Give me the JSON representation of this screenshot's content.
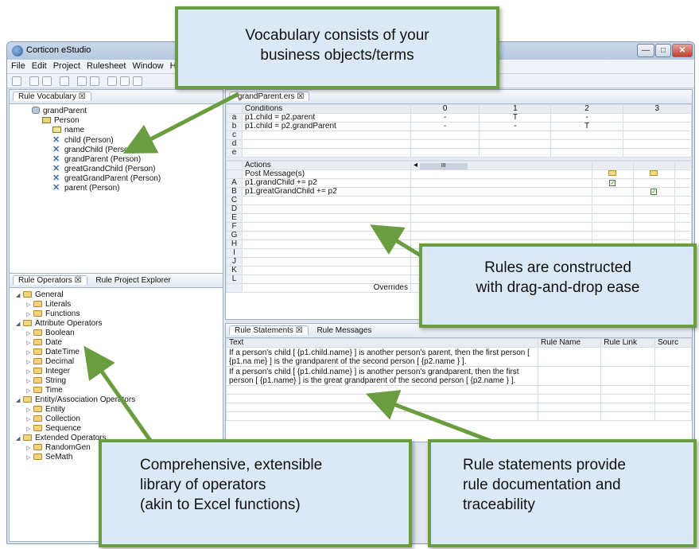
{
  "window": {
    "title": "Corticon eStudio",
    "minimize": "—",
    "maximize": "□",
    "close": "✕"
  },
  "menu": [
    "File",
    "Edit",
    "Project",
    "Rulesheet",
    "Window",
    "H"
  ],
  "vocabulary": {
    "tab": "Rule Vocabulary ☒",
    "root": "grandParent",
    "entity": "Person",
    "attribute": "name",
    "associations": [
      "child (Person)",
      "grandChild (Person)",
      "grandParent (Person)",
      "greatGrandChild (Person)",
      "greatGrandParent (Person)",
      "parent (Person)"
    ]
  },
  "operators": {
    "tab": "Rule Operators ☒",
    "tab2": "Rule Project Explorer",
    "items": [
      {
        "level": 0,
        "open": true,
        "label": "General"
      },
      {
        "level": 1,
        "open": false,
        "label": "Literals"
      },
      {
        "level": 1,
        "open": false,
        "label": "Functions"
      },
      {
        "level": 0,
        "open": true,
        "label": "Attribute Operators"
      },
      {
        "level": 1,
        "open": false,
        "label": "Boolean"
      },
      {
        "level": 1,
        "open": false,
        "label": "Date"
      },
      {
        "level": 1,
        "open": false,
        "label": "DateTime"
      },
      {
        "level": 1,
        "open": false,
        "label": "Decimal"
      },
      {
        "level": 1,
        "open": false,
        "label": "Integer"
      },
      {
        "level": 1,
        "open": false,
        "label": "String"
      },
      {
        "level": 1,
        "open": false,
        "label": "Time"
      },
      {
        "level": 0,
        "open": true,
        "label": "Entity/Association Operators"
      },
      {
        "level": 1,
        "open": false,
        "label": "Entity"
      },
      {
        "level": 1,
        "open": false,
        "label": "Collection"
      },
      {
        "level": 1,
        "open": false,
        "label": "Sequence"
      },
      {
        "level": 0,
        "open": true,
        "label": "Extended Operators"
      },
      {
        "level": 1,
        "open": false,
        "label": "RandomGen"
      },
      {
        "level": 1,
        "open": false,
        "label": "SeMath"
      }
    ]
  },
  "rulesheet": {
    "tab": "*grandParent.ers ☒",
    "conditions_header": "Conditions",
    "columns": [
      "0",
      "1",
      "2",
      "3"
    ],
    "conditions": [
      {
        "id": "a",
        "text": "p1.child = p2.parent",
        "vals": [
          "-",
          "T",
          "-",
          ""
        ]
      },
      {
        "id": "b",
        "text": "p1.child = p2.grandParent",
        "vals": [
          "-",
          "-",
          "T",
          ""
        ]
      },
      {
        "id": "c",
        "text": "",
        "vals": [
          "",
          "",
          "",
          ""
        ]
      },
      {
        "id": "d",
        "text": "",
        "vals": [
          "",
          "",
          "",
          ""
        ]
      },
      {
        "id": "e",
        "text": "",
        "vals": [
          "",
          "",
          "",
          ""
        ]
      }
    ],
    "actions_header": "Actions",
    "post_message": "Post Message(s)",
    "actions": [
      {
        "id": "A",
        "text": "p1.grandChild += p2"
      },
      {
        "id": "B",
        "text": "p1.greatGrandChild += p2"
      },
      {
        "id": "C",
        "text": ""
      },
      {
        "id": "D",
        "text": ""
      },
      {
        "id": "E",
        "text": ""
      },
      {
        "id": "F",
        "text": ""
      },
      {
        "id": "G",
        "text": ""
      },
      {
        "id": "H",
        "text": ""
      },
      {
        "id": "I",
        "text": ""
      },
      {
        "id": "J",
        "text": ""
      },
      {
        "id": "K",
        "text": ""
      },
      {
        "id": "L",
        "text": ""
      }
    ],
    "overrides": "Overrides",
    "scroll_glyph": "III"
  },
  "statements": {
    "tab": "Rule Statements ☒",
    "tab2": "Rule Messages",
    "headers": [
      "Text",
      "Rule Name",
      "Rule Link",
      "Sourc"
    ],
    "rows": [
      "If a person's child [ {p1.child.name} ] is another person's parent, then the first person [ {p1.na me} ] is the grandparent of the second person [ {p2.name } ].",
      "If a person's child [ {p1.child.name} ] is another person's grandparent, then the first person [ {p1.name} ] is the great grandparent of the second person [ {p2.name } ]."
    ]
  },
  "callouts": {
    "vocabulary": [
      "Vocabulary consists of your",
      "business objects/terms"
    ],
    "rules": [
      "Rules are constructed",
      "with drag-and-drop ease"
    ],
    "operators": [
      "Comprehensive, extensible",
      "library of operators",
      "(akin to Excel functions)"
    ],
    "statements": [
      "Rule statements provide",
      "rule documentation and",
      "traceability"
    ]
  },
  "colors": {
    "callout_border": "#6a9d3f",
    "callout_fill": "#dbe9f6",
    "arrow": "#6a9d3f"
  }
}
